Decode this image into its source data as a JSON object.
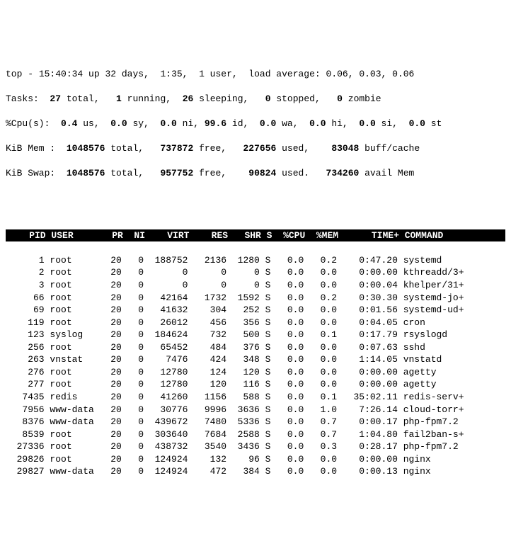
{
  "summary": {
    "line1": {
      "prefix": "top - ",
      "time": "15:40:34",
      "up_label": " up ",
      "uptime": "32 days,  1:35",
      "users_sep": ",  ",
      "users": "1 user",
      "load_label": ",  load average: ",
      "load": "0.06, 0.03, 0.06"
    },
    "tasks": {
      "label": "Tasks:  ",
      "total": "27",
      "total_suffix": " total,   ",
      "running": "1",
      "running_suffix": " running,  ",
      "sleeping": "26",
      "sleeping_suffix": " sleeping,   ",
      "stopped": "0",
      "stopped_suffix": " stopped,   ",
      "zombie": "0",
      "zombie_suffix": " zombie"
    },
    "cpu": {
      "label": "%Cpu(s):  ",
      "us": "0.4",
      "us_suffix": " us,  ",
      "sy": "0.0",
      "sy_suffix": " sy,  ",
      "ni": "0.0",
      "ni_suffix": " ni, ",
      "id": "99.6",
      "id_suffix": " id,  ",
      "wa": "0.0",
      "wa_suffix": " wa,  ",
      "hi": "0.0",
      "hi_suffix": " hi,  ",
      "si": "0.0",
      "si_suffix": " si,  ",
      "st": "0.0",
      "st_suffix": " st"
    },
    "mem": {
      "label": "KiB Mem :  ",
      "total": "1048576",
      "total_suffix": " total,   ",
      "free": "737872",
      "free_suffix": " free,   ",
      "used": "227656",
      "used_suffix": " used,    ",
      "buff": "83048",
      "buff_suffix": " buff/cache"
    },
    "swap": {
      "label": "KiB Swap:  ",
      "total": "1048576",
      "total_suffix": " total,   ",
      "free": "957752",
      "free_suffix": " free,    ",
      "used": "90824",
      "used_suffix": " used.   ",
      "avail": "734260",
      "avail_suffix": " avail Mem"
    }
  },
  "columns": {
    "PID": "PID",
    "USER": "USER",
    "PR": "PR",
    "NI": "NI",
    "VIRT": "VIRT",
    "RES": "RES",
    "SHR": "SHR",
    "S": "S",
    "CPU": "%CPU",
    "MEM": "%MEM",
    "TIME": "TIME+",
    "COMMAND": "COMMAND"
  },
  "rows": [
    {
      "pid": "1",
      "user": "root",
      "pr": "20",
      "ni": "0",
      "virt": "188752",
      "res": "2136",
      "shr": "1280",
      "s": "S",
      "cpu": "0.0",
      "mem": "0.2",
      "time": "0:47.20",
      "cmd": "systemd"
    },
    {
      "pid": "2",
      "user": "root",
      "pr": "20",
      "ni": "0",
      "virt": "0",
      "res": "0",
      "shr": "0",
      "s": "S",
      "cpu": "0.0",
      "mem": "0.0",
      "time": "0:00.00",
      "cmd": "kthreadd/3+"
    },
    {
      "pid": "3",
      "user": "root",
      "pr": "20",
      "ni": "0",
      "virt": "0",
      "res": "0",
      "shr": "0",
      "s": "S",
      "cpu": "0.0",
      "mem": "0.0",
      "time": "0:00.04",
      "cmd": "khelper/31+"
    },
    {
      "pid": "66",
      "user": "root",
      "pr": "20",
      "ni": "0",
      "virt": "42164",
      "res": "1732",
      "shr": "1592",
      "s": "S",
      "cpu": "0.0",
      "mem": "0.2",
      "time": "0:30.30",
      "cmd": "systemd-jo+"
    },
    {
      "pid": "69",
      "user": "root",
      "pr": "20",
      "ni": "0",
      "virt": "41632",
      "res": "304",
      "shr": "252",
      "s": "S",
      "cpu": "0.0",
      "mem": "0.0",
      "time": "0:01.56",
      "cmd": "systemd-ud+"
    },
    {
      "pid": "119",
      "user": "root",
      "pr": "20",
      "ni": "0",
      "virt": "26012",
      "res": "456",
      "shr": "356",
      "s": "S",
      "cpu": "0.0",
      "mem": "0.0",
      "time": "0:04.05",
      "cmd": "cron"
    },
    {
      "pid": "123",
      "user": "syslog",
      "pr": "20",
      "ni": "0",
      "virt": "184624",
      "res": "732",
      "shr": "500",
      "s": "S",
      "cpu": "0.0",
      "mem": "0.1",
      "time": "0:17.79",
      "cmd": "rsyslogd"
    },
    {
      "pid": "256",
      "user": "root",
      "pr": "20",
      "ni": "0",
      "virt": "65452",
      "res": "484",
      "shr": "376",
      "s": "S",
      "cpu": "0.0",
      "mem": "0.0",
      "time": "0:07.63",
      "cmd": "sshd"
    },
    {
      "pid": "263",
      "user": "vnstat",
      "pr": "20",
      "ni": "0",
      "virt": "7476",
      "res": "424",
      "shr": "348",
      "s": "S",
      "cpu": "0.0",
      "mem": "0.0",
      "time": "1:14.05",
      "cmd": "vnstatd"
    },
    {
      "pid": "276",
      "user": "root",
      "pr": "20",
      "ni": "0",
      "virt": "12780",
      "res": "124",
      "shr": "120",
      "s": "S",
      "cpu": "0.0",
      "mem": "0.0",
      "time": "0:00.00",
      "cmd": "agetty"
    },
    {
      "pid": "277",
      "user": "root",
      "pr": "20",
      "ni": "0",
      "virt": "12780",
      "res": "120",
      "shr": "116",
      "s": "S",
      "cpu": "0.0",
      "mem": "0.0",
      "time": "0:00.00",
      "cmd": "agetty"
    },
    {
      "pid": "7435",
      "user": "redis",
      "pr": "20",
      "ni": "0",
      "virt": "41260",
      "res": "1156",
      "shr": "588",
      "s": "S",
      "cpu": "0.0",
      "mem": "0.1",
      "time": "35:02.11",
      "cmd": "redis-serv+"
    },
    {
      "pid": "7956",
      "user": "www-data",
      "pr": "20",
      "ni": "0",
      "virt": "30776",
      "res": "9996",
      "shr": "3636",
      "s": "S",
      "cpu": "0.0",
      "mem": "1.0",
      "time": "7:26.14",
      "cmd": "cloud-torr+"
    },
    {
      "pid": "8376",
      "user": "www-data",
      "pr": "20",
      "ni": "0",
      "virt": "439672",
      "res": "7480",
      "shr": "5336",
      "s": "S",
      "cpu": "0.0",
      "mem": "0.7",
      "time": "0:00.17",
      "cmd": "php-fpm7.2"
    },
    {
      "pid": "8539",
      "user": "root",
      "pr": "20",
      "ni": "0",
      "virt": "303640",
      "res": "7684",
      "shr": "2588",
      "s": "S",
      "cpu": "0.0",
      "mem": "0.7",
      "time": "1:04.80",
      "cmd": "fail2ban-s+"
    },
    {
      "pid": "27336",
      "user": "root",
      "pr": "20",
      "ni": "0",
      "virt": "438732",
      "res": "3540",
      "shr": "3436",
      "s": "S",
      "cpu": "0.0",
      "mem": "0.3",
      "time": "0:28.17",
      "cmd": "php-fpm7.2"
    },
    {
      "pid": "29826",
      "user": "root",
      "pr": "20",
      "ni": "0",
      "virt": "124924",
      "res": "132",
      "shr": "96",
      "s": "S",
      "cpu": "0.0",
      "mem": "0.0",
      "time": "0:00.00",
      "cmd": "nginx"
    },
    {
      "pid": "29827",
      "user": "www-data",
      "pr": "20",
      "ni": "0",
      "virt": "124924",
      "res": "472",
      "shr": "384",
      "s": "S",
      "cpu": "0.0",
      "mem": "0.0",
      "time": "0:00.13",
      "cmd": "nginx"
    }
  ]
}
